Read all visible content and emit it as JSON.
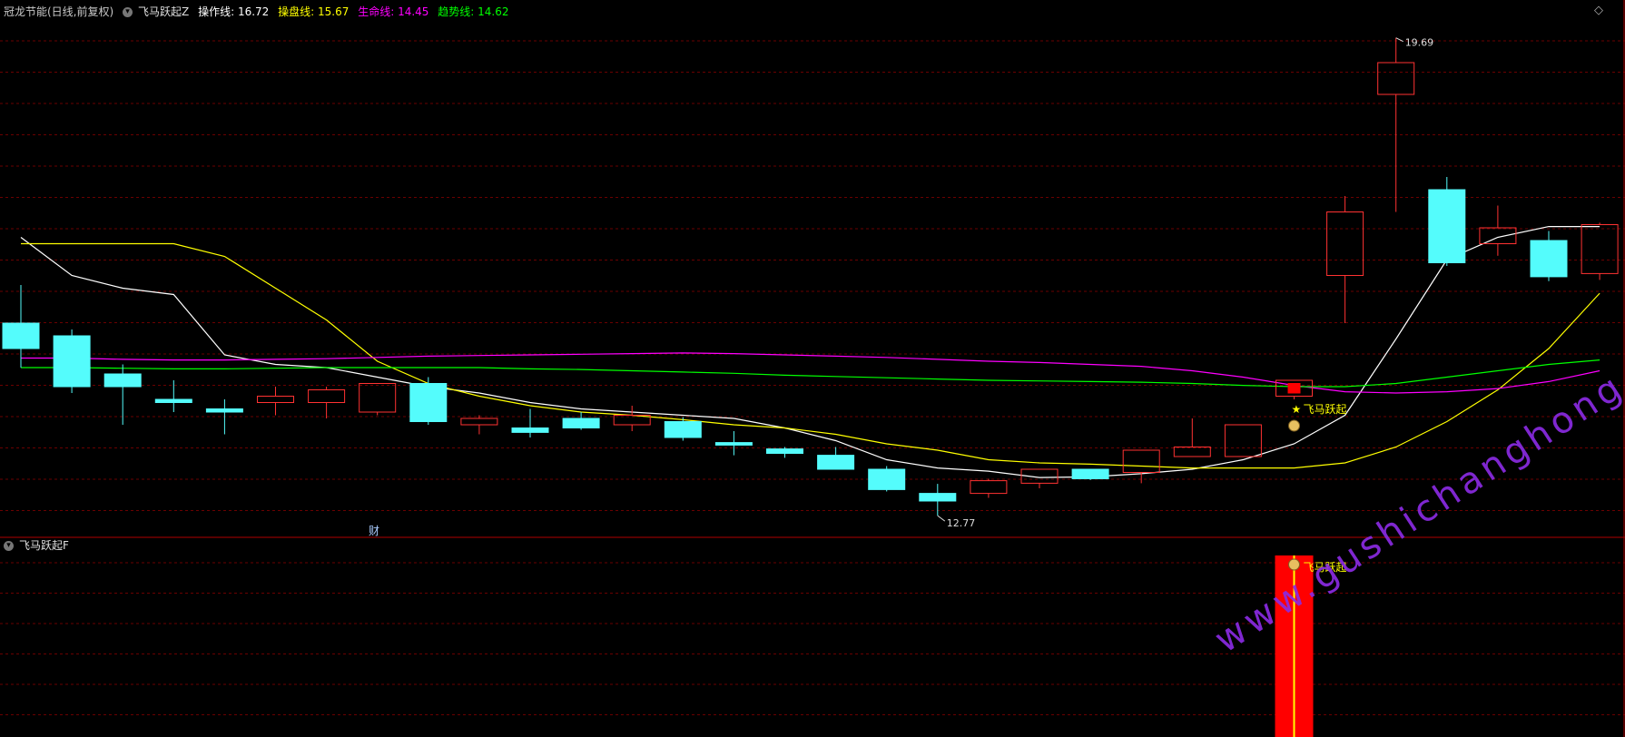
{
  "main_panel": {
    "stock_title": "冠龙节能(日线,前复权)",
    "indicator_name": "飞马跃起Z",
    "lines": [
      {
        "label": "操作线:",
        "value": "16.72",
        "color": "#ffffff"
      },
      {
        "label": "操盘线:",
        "value": "15.67",
        "color": "#ffff00"
      },
      {
        "label": "生命线:",
        "value": "14.45",
        "color": "#ff00ff"
      },
      {
        "label": "趋势线:",
        "value": "14.62",
        "color": "#00ff00"
      }
    ],
    "high_label": "19.69",
    "low_label": "12.77",
    "signal_text": "飞马跃起",
    "finance_marker": "财"
  },
  "sub_panel": {
    "indicator_name": "飞马跃起F",
    "signal_text": "飞马跃起"
  },
  "watermark": "www.gushichanghong.com",
  "chart_data": {
    "type": "candlestick",
    "price_range": [
      12.0,
      20.0
    ],
    "candles": [
      {
        "o": 15.2,
        "h": 15.8,
        "l": 14.5,
        "c": 14.8
      },
      {
        "o": 15.0,
        "h": 15.1,
        "l": 14.1,
        "c": 14.2
      },
      {
        "o": 14.4,
        "h": 14.55,
        "l": 13.6,
        "c": 14.2
      },
      {
        "o": 14.0,
        "h": 14.3,
        "l": 13.8,
        "c": 13.95
      },
      {
        "o": 13.85,
        "h": 14.0,
        "l": 13.45,
        "c": 13.8
      },
      {
        "o": 13.95,
        "h": 14.2,
        "l": 13.75,
        "c": 14.05
      },
      {
        "o": 13.95,
        "h": 14.2,
        "l": 13.7,
        "c": 14.15
      },
      {
        "o": 13.8,
        "h": 14.25,
        "l": 13.75,
        "c": 14.25
      },
      {
        "o": 14.25,
        "h": 14.35,
        "l": 13.6,
        "c": 13.65
      },
      {
        "o": 13.6,
        "h": 13.75,
        "l": 13.45,
        "c": 13.7
      },
      {
        "o": 13.55,
        "h": 13.85,
        "l": 13.4,
        "c": 13.48
      },
      {
        "o": 13.7,
        "h": 13.8,
        "l": 13.52,
        "c": 13.55
      },
      {
        "o": 13.6,
        "h": 13.9,
        "l": 13.5,
        "c": 13.75
      },
      {
        "o": 13.65,
        "h": 13.72,
        "l": 13.35,
        "c": 13.4
      },
      {
        "o": 13.32,
        "h": 13.5,
        "l": 13.12,
        "c": 13.28
      },
      {
        "o": 13.22,
        "h": 13.25,
        "l": 13.08,
        "c": 13.15
      },
      {
        "o": 13.12,
        "h": 13.25,
        "l": 12.9,
        "c": 12.9
      },
      {
        "o": 12.9,
        "h": 12.95,
        "l": 12.55,
        "c": 12.58
      },
      {
        "o": 12.52,
        "h": 12.67,
        "l": 12.17,
        "c": 12.4
      },
      {
        "o": 12.52,
        "h": 12.75,
        "l": 12.45,
        "c": 12.72
      },
      {
        "o": 12.68,
        "h": 12.9,
        "l": 12.6,
        "c": 12.9
      },
      {
        "o": 12.9,
        "h": 12.9,
        "l": 12.73,
        "c": 12.75
      },
      {
        "o": 12.85,
        "h": 13.2,
        "l": 12.68,
        "c": 13.2
      },
      {
        "o": 13.1,
        "h": 13.7,
        "l": 13.1,
        "c": 13.25
      },
      {
        "o": 13.1,
        "h": 13.6,
        "l": 13.1,
        "c": 13.6
      },
      {
        "o": 14.05,
        "h": 14.3,
        "l": 14.0,
        "c": 14.3
      },
      {
        "o": 15.95,
        "h": 17.2,
        "l": 15.2,
        "c": 16.95
      },
      {
        "o": 18.8,
        "h": 19.69,
        "l": 16.95,
        "c": 19.3
      },
      {
        "o": 17.3,
        "h": 17.5,
        "l": 16.1,
        "c": 16.15
      },
      {
        "o": 16.45,
        "h": 17.05,
        "l": 16.26,
        "c": 16.7
      },
      {
        "o": 16.5,
        "h": 16.65,
        "l": 15.86,
        "c": 15.93
      },
      {
        "o": 15.98,
        "h": 16.78,
        "l": 15.88,
        "c": 16.75
      }
    ],
    "filled_red_index": 25,
    "series": [
      {
        "name": "操作线",
        "color": "#ffffff",
        "values": [
          16.55,
          15.95,
          15.75,
          15.65,
          14.7,
          14.55,
          14.5,
          14.35,
          14.2,
          14.1,
          13.95,
          13.85,
          13.8,
          13.75,
          13.7,
          13.55,
          13.35,
          13.05,
          12.92,
          12.87,
          12.77,
          12.78,
          12.83,
          12.9,
          13.05,
          13.3,
          13.75,
          14.95,
          16.2,
          16.55,
          16.72,
          16.72
        ]
      },
      {
        "name": "操盘线",
        "color": "#ffff00",
        "values": [
          16.45,
          16.45,
          16.45,
          16.45,
          16.25,
          15.75,
          15.25,
          14.6,
          14.25,
          14.05,
          13.9,
          13.8,
          13.75,
          13.68,
          13.6,
          13.55,
          13.45,
          13.3,
          13.2,
          13.05,
          13.0,
          12.98,
          12.95,
          12.92,
          12.92,
          12.92,
          13.0,
          13.25,
          13.65,
          14.15,
          14.8,
          15.67
        ]
      },
      {
        "name": "生命线",
        "color": "#ff00ff",
        "values": [
          14.65,
          14.65,
          14.63,
          14.62,
          14.62,
          14.63,
          14.64,
          14.66,
          14.68,
          14.69,
          14.7,
          14.71,
          14.72,
          14.73,
          14.72,
          14.7,
          14.68,
          14.66,
          14.63,
          14.6,
          14.58,
          14.55,
          14.52,
          14.45,
          14.35,
          14.22,
          14.12,
          14.1,
          14.12,
          14.17,
          14.28,
          14.45
        ]
      },
      {
        "name": "趋势线",
        "color": "#00ff00",
        "values": [
          14.5,
          14.5,
          14.49,
          14.48,
          14.48,
          14.49,
          14.5,
          14.5,
          14.5,
          14.5,
          14.48,
          14.47,
          14.45,
          14.43,
          14.41,
          14.38,
          14.36,
          14.34,
          14.32,
          14.3,
          14.29,
          14.28,
          14.27,
          14.25,
          14.22,
          14.2,
          14.2,
          14.25,
          14.35,
          14.45,
          14.55,
          14.62
        ]
      }
    ],
    "high_index": 27,
    "low_index": 18,
    "signal_index": 25
  },
  "colors": {
    "background": "#000000",
    "grid": "#6a0000",
    "up_candle": "#ff3232",
    "down_candle": "#54fcfc",
    "signal_bar": "#ff0000",
    "signal_line": "#ffff00",
    "panel_border": "#b00000",
    "finance_marker": "#aaccff"
  }
}
